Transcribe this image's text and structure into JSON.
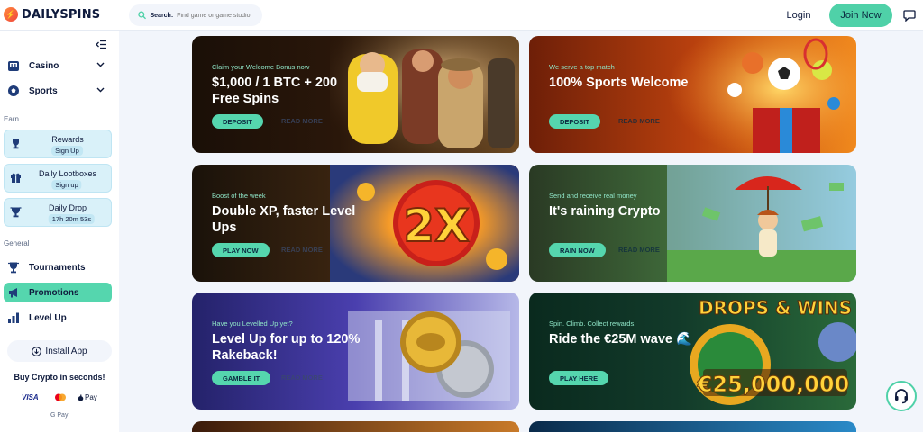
{
  "brand": {
    "name": "DAILYSPINS"
  },
  "header": {
    "search_label": "Search:",
    "search_placeholder": "Find game or game studio",
    "login": "Login",
    "join": "Join Now"
  },
  "sidebar": {
    "top": [
      {
        "label": "Casino",
        "icon": "casino-icon"
      },
      {
        "label": "Sports",
        "icon": "sports-icon"
      }
    ],
    "earn_heading": "Earn",
    "earn": [
      {
        "label": "Rewards",
        "pill": "Sign Up",
        "icon": "trophy-icon"
      },
      {
        "label": "Daily Lootboxes",
        "pill": "Sign up",
        "icon": "gift-icon"
      },
      {
        "label": "Daily Drop",
        "pill": "17h 20m 53s",
        "icon": "drop-trophy-icon"
      }
    ],
    "general_heading": "General",
    "general": [
      {
        "label": "Tournaments",
        "icon": "tournament-icon"
      },
      {
        "label": "Promotions",
        "icon": "megaphone-icon",
        "active": true
      },
      {
        "label": "Level Up",
        "icon": "bars-icon"
      }
    ],
    "install": "Install App",
    "buy_crypto": "Buy Crypto in seconds!",
    "payments": [
      "VISA",
      "Pay",
      "G Pay"
    ]
  },
  "promos": [
    {
      "eyebrow": "Claim your Welcome Bonus now",
      "title": "$1,000 / 1 BTC + 200 Free Spins",
      "cta": "DEPOSIT",
      "more": "READ MORE",
      "theme": "welcome-casino"
    },
    {
      "eyebrow": "We serve a top match",
      "title": "100% Sports Welcome",
      "cta": "DEPOSIT",
      "more": "READ MORE",
      "theme": "sports"
    },
    {
      "eyebrow": "Boost of the week",
      "title": "Double XP, faster Level Ups",
      "cta": "PLAY NOW",
      "more": "READ MORE",
      "theme": "double-xp",
      "art_text": "2X"
    },
    {
      "eyebrow": "Send and receive real money",
      "title": "It's raining Crypto",
      "cta": "RAIN NOW",
      "more": "READ MORE",
      "theme": "rain"
    },
    {
      "eyebrow": "Have you Levelled Up yet?",
      "title": "Level Up for up to 120% Rakeback!",
      "cta": "GAMBLE IT",
      "more": "READ MORE",
      "theme": "rakeback"
    },
    {
      "eyebrow": "Spin. Climb. Collect rewards.",
      "title": "Ride the €25M wave 🌊",
      "cta": "PLAY HERE",
      "more": "",
      "theme": "drops-wins",
      "art_title": "DROPS & WINS",
      "art_amount": "€25,000,000"
    }
  ],
  "colors": {
    "accent": "#55d6ae",
    "sidebar_active": "#55d6ae",
    "earn_bg": "#d9f1f9"
  }
}
